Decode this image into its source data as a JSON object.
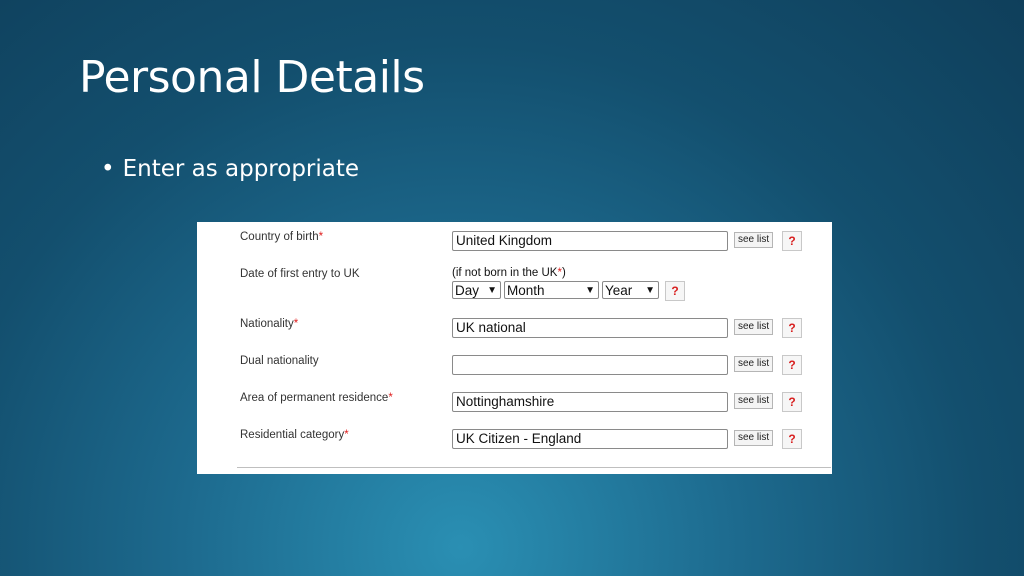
{
  "slide": {
    "title": "Personal Details",
    "bullet": "Enter as appropriate"
  },
  "form": {
    "see_list_label": "see list",
    "help_label": "?",
    "required_marker": "*",
    "country_of_birth": {
      "label": "Country of birth",
      "value": "United Kingdom"
    },
    "first_entry": {
      "label": "Date of first entry to UK",
      "note_prefix": "(if not born in the UK",
      "note_suffix": ")",
      "day": "Day",
      "month": "Month",
      "year": "Year"
    },
    "nationality": {
      "label": "Nationality",
      "value": "UK national"
    },
    "dual_nationality": {
      "label": "Dual nationality",
      "value": ""
    },
    "residence_area": {
      "label": "Area of permanent residence",
      "value": "Nottinghamshire"
    },
    "residential_category": {
      "label": "Residential category",
      "value": "UK Citizen - England"
    }
  },
  "colors": {
    "required": "#e02020",
    "help": "#d82020"
  }
}
